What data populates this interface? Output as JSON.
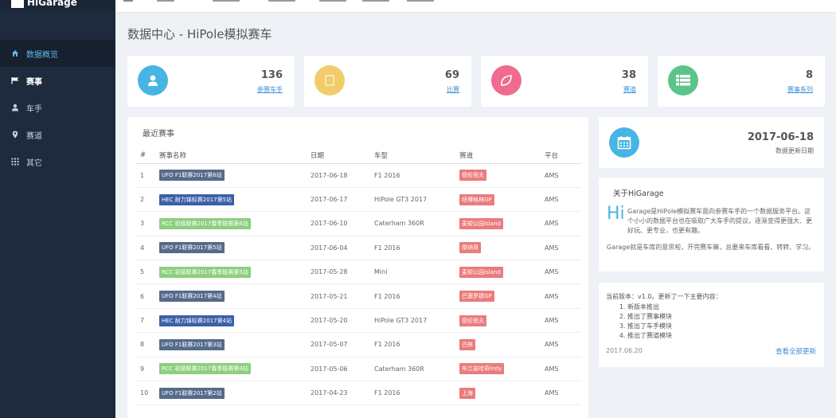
{
  "brand": "HiGarage",
  "sidebar": {
    "items": [
      {
        "label": "数据概览",
        "icon": "home-icon"
      },
      {
        "label": "赛事",
        "icon": "flag-icon"
      },
      {
        "label": "车手",
        "icon": "user-icon"
      },
      {
        "label": "赛道",
        "icon": "map-marker-icon"
      },
      {
        "label": "其它",
        "icon": "grid-icon"
      }
    ]
  },
  "page_title": "数据中心 - HiPole模拟赛车",
  "stats": [
    {
      "value": "136",
      "label": "参赛车手",
      "color": "#48b4e4",
      "icon": "user-icon"
    },
    {
      "value": "69",
      "label": "比赛",
      "color": "#f0cc6b",
      "icon": "square-icon"
    },
    {
      "value": "38",
      "label": "赛道",
      "color": "#f06b8f",
      "icon": "leaf-icon"
    },
    {
      "value": "8",
      "label": "赛事系列",
      "color": "#5cc48a",
      "icon": "list-icon"
    }
  ],
  "recent": {
    "title": "最近赛事",
    "headers": [
      "#",
      "赛事名称",
      "日期",
      "车型",
      "赛道",
      "平台"
    ],
    "rows": [
      {
        "n": "1",
        "name": "UFO F1联赛2017第6站",
        "nc": "#546b8c",
        "date": "2017-06-18",
        "car": "F1 2016",
        "track": "德伦祖夫",
        "platform": "AMS"
      },
      {
        "n": "2",
        "name": "HEC 耐力锦标赛2017第5站",
        "nc": "#3a60a8",
        "date": "2017-06-17",
        "car": "HiPole GT3 2017",
        "track": "纽博格林GP",
        "platform": "AMS"
      },
      {
        "n": "3",
        "name": "RCC 初级联赛2017春季联赛第6站",
        "nc": "#8ccf7e",
        "date": "2017-06-10",
        "car": "Caterham 360R",
        "track": "麦顿公园Island",
        "platform": "AMS"
      },
      {
        "n": "4",
        "name": "UFO F1联赛2017第5站",
        "nc": "#546b8c",
        "date": "2017-06-04",
        "car": "F1 2016",
        "track": "摩纳哥",
        "platform": "AMS"
      },
      {
        "n": "5",
        "name": "RCC 初级联赛2017春季联赛第5站",
        "nc": "#8ccf7e",
        "date": "2017-05-28",
        "car": "Mini",
        "track": "麦顿公园Island",
        "platform": "AMS"
      },
      {
        "n": "6",
        "name": "UFO F1联赛2017第4站",
        "nc": "#546b8c",
        "date": "2017-05-21",
        "car": "F1 2016",
        "track": "巴塞罗那GP",
        "platform": "AMS"
      },
      {
        "n": "7",
        "name": "HEC 耐力锦标赛2017第4站",
        "nc": "#3a60a8",
        "date": "2017-05-20",
        "car": "HiPole GT3 2017",
        "track": "德伦祖夫",
        "platform": "AMS"
      },
      {
        "n": "8",
        "name": "UFO F1联赛2017第3站",
        "nc": "#546b8c",
        "date": "2017-05-07",
        "car": "F1 2016",
        "track": "巴林",
        "platform": "AMS"
      },
      {
        "n": "9",
        "name": "RCC 初级联赛2017春季联赛第4站",
        "nc": "#8ccf7e",
        "date": "2017-05-06",
        "car": "Caterham 360R",
        "track": "布兰兹哈奇Indy",
        "platform": "AMS"
      },
      {
        "n": "10",
        "name": "UFO F1联赛2017第2站",
        "nc": "#546b8c",
        "date": "2017-04-23",
        "car": "F1 2016",
        "track": "上海",
        "platform": "AMS"
      }
    ]
  },
  "update": {
    "date": "2017-06-18",
    "label": "数据更新日期"
  },
  "about": {
    "title": "关于HiGarage",
    "hi": "Hi",
    "p1": "Garage是HiPole模拟赛车面向参赛车手的一个数据服务平台。这个小小的数据平台也在吸取广大车手的提议，逐渐变得更强大、更好玩、更专业，也更有趣。",
    "p2": "Garage就是车库的意思啦，开完赛车嘛，总要来车库看看、转转、学习。"
  },
  "version": {
    "title": "当前版本：v1.0。更新了一下主要内容：",
    "items": [
      "新版本推出",
      "推出了赛事模块",
      "推出了车手模块",
      "推出了赛道模块"
    ],
    "date": "2017.06.20",
    "link": "查看全部更新"
  }
}
